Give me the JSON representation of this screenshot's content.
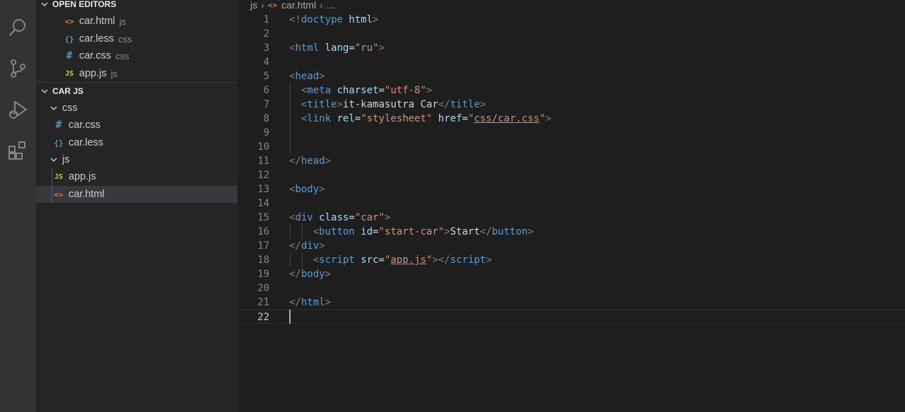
{
  "activity_bar": [
    {
      "name": "search-icon"
    },
    {
      "name": "source-control-icon"
    },
    {
      "name": "run-debug-icon"
    },
    {
      "name": "extensions-icon"
    }
  ],
  "open_editors": {
    "title": "OPEN EDITORS",
    "items": [
      {
        "icon": "<>",
        "icon_type": "html",
        "label": "car.html",
        "desc": "js"
      },
      {
        "icon": "{}",
        "icon_type": "less",
        "label": "car.less",
        "desc": "css"
      },
      {
        "icon": "#",
        "icon_type": "css",
        "label": "car.css",
        "desc": "css"
      },
      {
        "icon": "JS",
        "icon_type": "js",
        "label": "app.js",
        "desc": "js"
      }
    ]
  },
  "explorer": {
    "title": "CAR JS",
    "folders": [
      {
        "label": "css",
        "files": [
          {
            "icon": "#",
            "icon_type": "css",
            "label": "car.css"
          },
          {
            "icon": "{}",
            "icon_type": "less",
            "label": "car.less"
          }
        ]
      },
      {
        "label": "js",
        "files": [
          {
            "icon": "JS",
            "icon_type": "js",
            "label": "app.js"
          },
          {
            "icon": "<>",
            "icon_type": "html",
            "label": "car.html",
            "selected": true
          }
        ]
      }
    ]
  },
  "breadcrumb": {
    "folder": "js",
    "file_icon": "<>",
    "file": "car.html",
    "more": "..."
  },
  "code": {
    "current_line": 22,
    "lines": [
      [
        [
          "punct",
          "<!"
        ],
        [
          "tag",
          "doctype"
        ],
        [
          "text",
          " "
        ],
        [
          "attr",
          "html"
        ],
        [
          "punct",
          ">"
        ]
      ],
      [],
      [
        [
          "punct",
          "<"
        ],
        [
          "tag",
          "html"
        ],
        [
          "text",
          " "
        ],
        [
          "attr",
          "lang"
        ],
        [
          "text",
          "="
        ],
        [
          "str",
          "\"ru\""
        ],
        [
          "punct",
          ">"
        ]
      ],
      [],
      [
        [
          "punct",
          "<"
        ],
        [
          "tag",
          "head"
        ],
        [
          "punct",
          ">"
        ]
      ],
      [
        [
          "text",
          "  "
        ],
        [
          "punct",
          "<"
        ],
        [
          "tag",
          "meta"
        ],
        [
          "text",
          " "
        ],
        [
          "attr",
          "charset"
        ],
        [
          "text",
          "="
        ],
        [
          "str",
          "\"utf-8\""
        ],
        [
          "punct",
          ">"
        ]
      ],
      [
        [
          "text",
          "  "
        ],
        [
          "punct",
          "<"
        ],
        [
          "tag",
          "title"
        ],
        [
          "punct",
          ">"
        ],
        [
          "text",
          "it-kamasutra Car"
        ],
        [
          "punct",
          "</"
        ],
        [
          "tag",
          "title"
        ],
        [
          "punct",
          ">"
        ]
      ],
      [
        [
          "text",
          "  "
        ],
        [
          "punct",
          "<"
        ],
        [
          "tag",
          "link"
        ],
        [
          "text",
          " "
        ],
        [
          "attr",
          "rel"
        ],
        [
          "text",
          "="
        ],
        [
          "str",
          "\"stylesheet\""
        ],
        [
          "text",
          " "
        ],
        [
          "attr",
          "href"
        ],
        [
          "text",
          "="
        ],
        [
          "str",
          "\""
        ],
        [
          "link",
          "css/car.css"
        ],
        [
          "str",
          "\""
        ],
        [
          "punct",
          ">"
        ]
      ],
      [],
      [],
      [
        [
          "punct",
          "</"
        ],
        [
          "tag",
          "head"
        ],
        [
          "punct",
          ">"
        ]
      ],
      [],
      [
        [
          "punct",
          "<"
        ],
        [
          "tag",
          "body"
        ],
        [
          "punct",
          ">"
        ]
      ],
      [],
      [
        [
          "punct",
          "<"
        ],
        [
          "tag",
          "div"
        ],
        [
          "text",
          " "
        ],
        [
          "attr",
          "class"
        ],
        [
          "text",
          "="
        ],
        [
          "str",
          "\"car\""
        ],
        [
          "punct",
          ">"
        ]
      ],
      [
        [
          "text",
          "    "
        ],
        [
          "punct",
          "<"
        ],
        [
          "tag",
          "button"
        ],
        [
          "text",
          " "
        ],
        [
          "attr",
          "id"
        ],
        [
          "text",
          "="
        ],
        [
          "str",
          "\"start-car\""
        ],
        [
          "punct",
          ">"
        ],
        [
          "text",
          "Start"
        ],
        [
          "punct",
          "</"
        ],
        [
          "tag",
          "button"
        ],
        [
          "punct",
          ">"
        ]
      ],
      [
        [
          "punct",
          "</"
        ],
        [
          "tag",
          "div"
        ],
        [
          "punct",
          ">"
        ]
      ],
      [
        [
          "text",
          "    "
        ],
        [
          "punct",
          "<"
        ],
        [
          "tag",
          "script"
        ],
        [
          "text",
          " "
        ],
        [
          "attr",
          "src"
        ],
        [
          "text",
          "="
        ],
        [
          "str",
          "\""
        ],
        [
          "link",
          "app.js"
        ],
        [
          "str",
          "\""
        ],
        [
          "punct",
          "></"
        ],
        [
          "tag",
          "script"
        ],
        [
          "punct",
          ">"
        ]
      ],
      [
        [
          "punct",
          "</"
        ],
        [
          "tag",
          "body"
        ],
        [
          "punct",
          ">"
        ]
      ],
      [],
      [
        [
          "punct",
          "</"
        ],
        [
          "tag",
          "html"
        ],
        [
          "punct",
          ">"
        ]
      ],
      []
    ]
  },
  "colors": {
    "background": "#1e1e1e",
    "sidebar": "#252526",
    "activity_bar": "#333333",
    "tag": "#569cd6",
    "attribute": "#9cdcfe",
    "string": "#ce9178",
    "html_icon": "#e37933",
    "css_icon": "#519aba",
    "js_icon": "#cbcb41"
  }
}
